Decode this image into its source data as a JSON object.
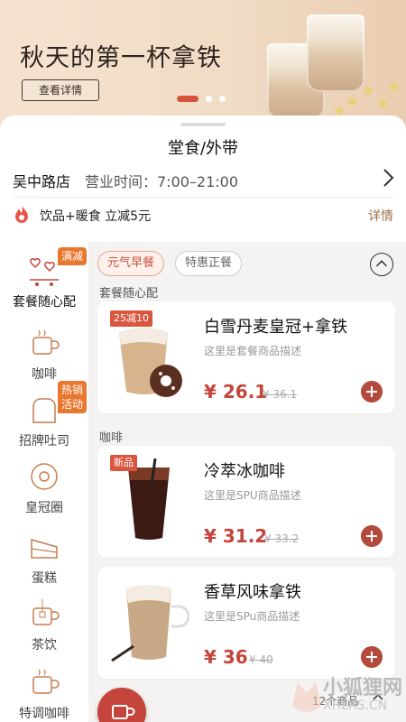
{
  "banner": {
    "title": "秋天的第一杯拿铁",
    "button_label": "查看详情",
    "pages": 3,
    "active_page": 1,
    "accent_color": "#d6523b"
  },
  "header": {
    "mode": "堂食/外带",
    "store_name": "吴中路店",
    "hours": "营业时间：7:00–21:00",
    "promo_text": "饮品+暖食 立减5元",
    "promo_link": "详情"
  },
  "sidebar": {
    "items": [
      {
        "label": "套餐随心配",
        "icon": "cart-hearts-icon",
        "badge": "满减",
        "active": true
      },
      {
        "label": "咖啡",
        "icon": "coffee-cup-icon",
        "badge": ""
      },
      {
        "label": "招牌吐司",
        "icon": "toast-icon",
        "badge": "热销\n活动"
      },
      {
        "label": "皇冠圈",
        "icon": "donut-icon",
        "badge": ""
      },
      {
        "label": "蛋糕",
        "icon": "cake-icon",
        "badge": ""
      },
      {
        "label": "茶饮",
        "icon": "tea-icon",
        "badge": ""
      },
      {
        "label": "特调咖啡",
        "icon": "special-coffee-icon",
        "badge": ""
      }
    ]
  },
  "tabs": [
    {
      "label": "元气早餐",
      "active": true
    },
    {
      "label": "特惠正餐",
      "active": false
    }
  ],
  "sections": [
    {
      "title": "套餐随心配",
      "products": [
        {
          "name": "白雪丹麦皇冠+拿铁",
          "desc": "这里是套餐商品描述",
          "price": "¥ 26.1",
          "orig": "¥ 36.1",
          "tag": "25减10",
          "image": "latte-donut-icon"
        }
      ]
    },
    {
      "title": "咖啡",
      "products": [
        {
          "name": "冷萃冰咖啡",
          "desc": "这里是SPU商品描述",
          "price": "¥ 31.2",
          "orig": "¥ 33.2",
          "tag": "新品",
          "image": "iced-coffee-icon"
        },
        {
          "name": "香草风味拿铁",
          "desc": "这里是SPu商品描述",
          "price": "¥ 36",
          "orig": "¥ 40",
          "tag": "",
          "image": "vanilla-latte-icon"
        }
      ]
    }
  ],
  "cart": {
    "count_text": "12个商品"
  },
  "watermark": {
    "line1": "小狐狸网",
    "line2": "XHLRS.CN"
  },
  "colors": {
    "price": "#c4453b",
    "badge": "#e9772e",
    "add_button": "#b34a3c",
    "tab_active": "#c4533d"
  }
}
